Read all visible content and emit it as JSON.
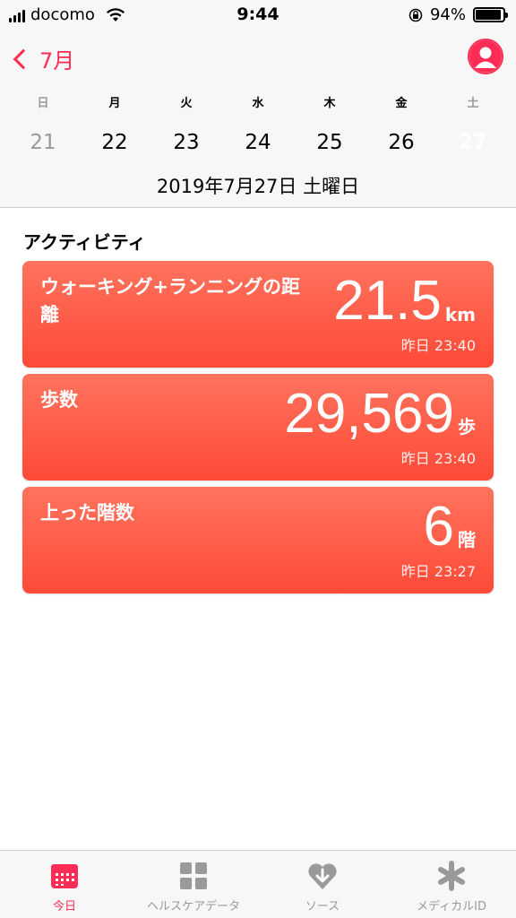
{
  "status": {
    "carrier": "docomo",
    "time": "9:44",
    "battery": "94%",
    "battery_level": 0.94
  },
  "header": {
    "back_label": "7月",
    "weekdays": [
      "日",
      "月",
      "火",
      "水",
      "木",
      "金",
      "土"
    ],
    "dates": [
      "21",
      "22",
      "23",
      "24",
      "25",
      "26",
      "27"
    ],
    "full_date": "2019年7月27日 土曜日"
  },
  "section": {
    "title": "アクティビティ"
  },
  "cards": [
    {
      "label": "ウォーキング+ランニングの距離",
      "value": "21.5",
      "unit": "km",
      "time": "昨日 23:40"
    },
    {
      "label": "歩数",
      "value": "29,569",
      "unit": "歩",
      "time": "昨日 23:40"
    },
    {
      "label": "上った階数",
      "value": "6",
      "unit": "階",
      "time": "昨日 23:27"
    }
  ],
  "tabs": [
    {
      "label": "今日",
      "icon": "calendar-icon"
    },
    {
      "label": "ヘルスケアデータ",
      "icon": "grid-icon"
    },
    {
      "label": "ソース",
      "icon": "heart-download-icon"
    },
    {
      "label": "メディカルID",
      "icon": "asterisk-icon"
    }
  ],
  "colors": {
    "accent": "#ff2d55",
    "card_top": "#ff735e",
    "card_bottom": "#fe4a37",
    "selected_date": "#000000"
  }
}
